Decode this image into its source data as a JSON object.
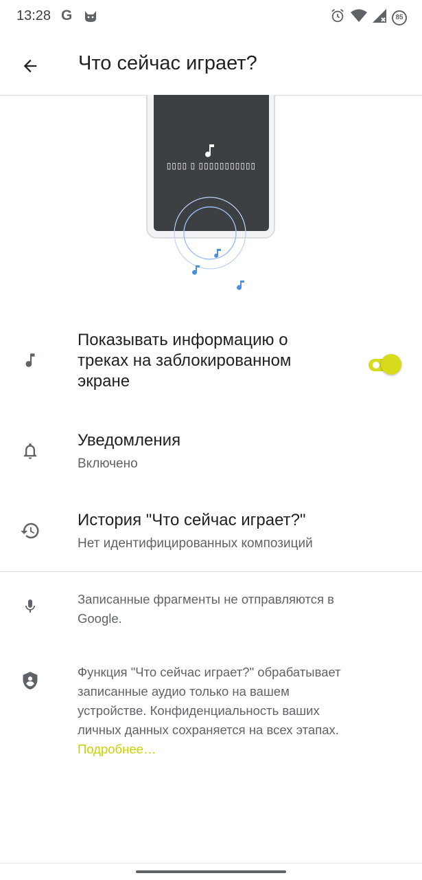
{
  "status_bar": {
    "time": "13:28",
    "g_label": "G",
    "battery_level": "85",
    "icons": [
      "google-icon",
      "cat-icon",
      "alarm-icon",
      "wifi-icon",
      "signal-icon",
      "battery-icon"
    ]
  },
  "app_bar": {
    "title": "Что сейчас играет?",
    "back_icon": "arrow-back-icon"
  },
  "illustration": {
    "phone_text": "▯▯▯▯ ▯ ▯▯▯▯▯▯▯▯▯▯▯",
    "note_color": "#4a8fe0"
  },
  "settings": {
    "lockscreen": {
      "icon": "music-note-icon",
      "label_line1": "Показывать информацию о",
      "label_line2": "треках на заблокированном",
      "label_line3": "экране",
      "toggle_on": true
    },
    "notifications": {
      "icon": "bell-icon",
      "title": "Уведомления",
      "subtitle": "Включено"
    },
    "history": {
      "icon": "history-icon",
      "title": "История \"Что сейчас играет?\"",
      "subtitle": "Нет идентифицированных композиций"
    }
  },
  "info": {
    "mic": {
      "icon": "microphone-icon",
      "line1": "Записанные фрагменты не отправляются в",
      "line2": "Google."
    },
    "privacy": {
      "icon": "shield-person-icon",
      "line1": "Функция \"Что сейчас играет?\" обрабатывает",
      "line2": "записанные аудио только на вашем",
      "line3": "устройстве. Конфиденциальность ваших",
      "line4": "личных данных сохраняется на всех этапах.",
      "link": "Подробнее…"
    }
  },
  "colors": {
    "accent": "#d6dc1c",
    "link": "#c8d200",
    "icon": "#5f6368"
  }
}
